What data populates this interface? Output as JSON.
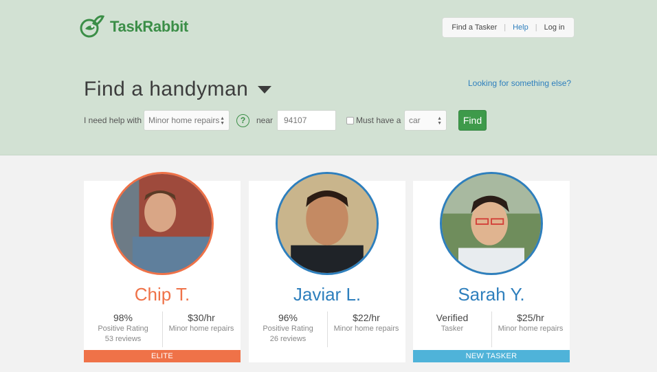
{
  "brand": {
    "name": "TaskRabbit",
    "color": "#3b8e47"
  },
  "nav": {
    "find_tasker": "Find a Tasker",
    "help": "Help",
    "login": "Log in",
    "sep": "|"
  },
  "hero": {
    "headline": "Find a handyman",
    "looking_else": "Looking for something else?",
    "form": {
      "need_help_label": "I need help with",
      "category_value": "Minor home repairs",
      "near_label": "near",
      "zip_value": "94107",
      "must_have_label": "Must have a",
      "vehicle_value": "car",
      "find_label": "Find",
      "help_glyph": "?"
    }
  },
  "taskers": [
    {
      "name": "Chip T.",
      "stat1_big": "98%",
      "stat1_line1": "Positive Rating",
      "stat1_line2": "53 reviews",
      "rate": "$30/hr",
      "rate_sub": "Minor home repairs",
      "badge": "ELITE"
    },
    {
      "name": "Javiar L.",
      "stat1_big": "96%",
      "stat1_line1": "Positive Rating",
      "stat1_line2": "26 reviews",
      "rate": "$22/hr",
      "rate_sub": "Minor home repairs",
      "badge": ""
    },
    {
      "name": "Sarah Y.",
      "stat1_big": "Verified",
      "stat1_line1": "Tasker",
      "stat1_line2": "",
      "rate": "$25/hr",
      "rate_sub": "Minor home repairs",
      "badge": "NEW TASKER"
    }
  ],
  "colors": {
    "elite": "#ef7248",
    "new": "#4fb3d9",
    "link": "#2e7fbd",
    "hero_bg": "#d2e1d3"
  }
}
